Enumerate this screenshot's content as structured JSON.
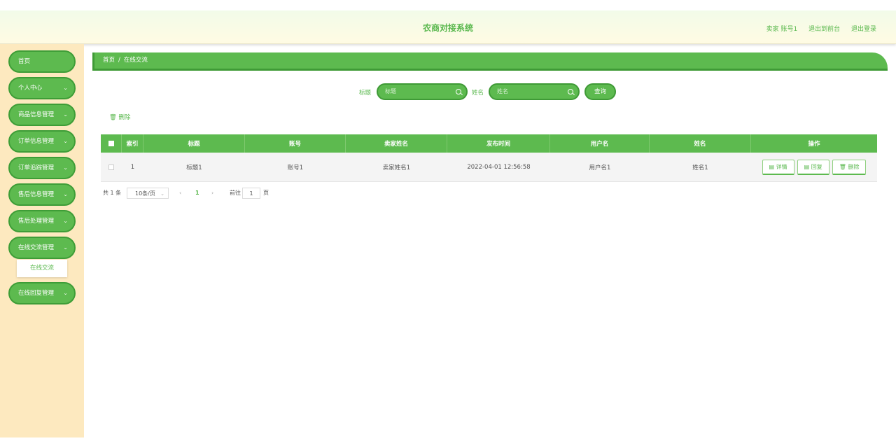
{
  "header": {
    "title": "农商对接系统",
    "user": "卖家 账号1",
    "to_front": "退出到前台",
    "logout": "退出登录"
  },
  "sidebar": {
    "items": [
      {
        "label": "首页"
      },
      {
        "label": "个人中心"
      },
      {
        "label": "商品信息管理"
      },
      {
        "label": "订单信息管理"
      },
      {
        "label": "订单追踪管理"
      },
      {
        "label": "售后信息管理"
      },
      {
        "label": "售后处理管理"
      },
      {
        "label": "在线交流管理"
      },
      {
        "label": "在线回复管理"
      }
    ],
    "submenu": "在线交流",
    "chevron": "⌄"
  },
  "breadcrumb": {
    "home": "首页",
    "separator": "/",
    "current": "在线交流"
  },
  "search": {
    "title_label": "标题",
    "title_placeholder": "标题",
    "name_label": "姓名",
    "name_placeholder": "姓名",
    "query_button": "查询"
  },
  "toolbar": {
    "delete_label": "🗑 删除"
  },
  "table": {
    "headers": [
      "索引",
      "标题",
      "账号",
      "卖家姓名",
      "发布时间",
      "用户名",
      "姓名",
      "操作"
    ],
    "rows": [
      {
        "index": "1",
        "title": "标题1",
        "account": "账号1",
        "seller": "卖家姓名1",
        "time": "2022-04-01 12:56:58",
        "username": "用户名1",
        "name": "姓名1"
      }
    ],
    "actions": {
      "detail": "▤ 详情",
      "reply": "▤ 回复",
      "delete": "🗑 删除"
    }
  },
  "pagination": {
    "total": "共 1 条",
    "page_size": "10条/页",
    "prev": "‹",
    "current": "1",
    "next": "›",
    "goto_label": "前往",
    "goto_value": "1",
    "page_unit": "页"
  },
  "colors": {
    "primary": "#5dba4f",
    "primary_dark": "#3f9a36",
    "sidebar_bg": "#fde9bf"
  }
}
